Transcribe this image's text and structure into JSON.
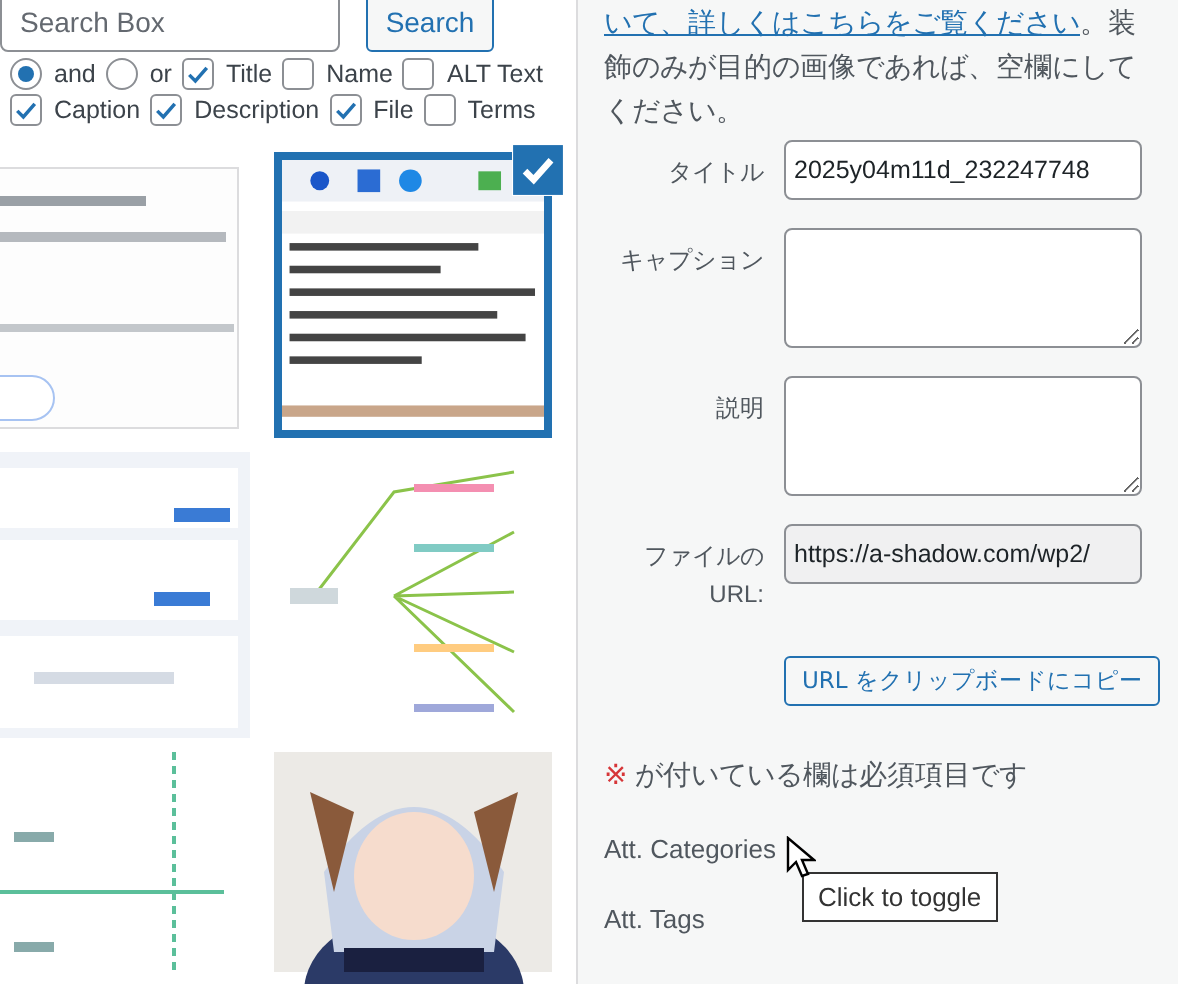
{
  "search": {
    "placeholder": "Search Box",
    "button": "Search"
  },
  "options": [
    {
      "kind": "radio",
      "label": "and",
      "selected": true
    },
    {
      "kind": "radio",
      "label": "or",
      "selected": false
    },
    {
      "kind": "checkbox",
      "label": "Title",
      "checked": true
    },
    {
      "kind": "checkbox",
      "label": "Name",
      "checked": false
    },
    {
      "kind": "checkbox",
      "label": "ALT Text",
      "checked": false
    },
    {
      "kind": "break"
    },
    {
      "kind": "checkbox",
      "label": "Caption",
      "checked": true
    },
    {
      "kind": "checkbox",
      "label": "Description",
      "checked": true
    },
    {
      "kind": "checkbox",
      "label": "File",
      "checked": true
    },
    {
      "kind": "checkbox",
      "label": "Terms",
      "checked": false
    }
  ],
  "thumbnails": [
    {
      "kind": "picture",
      "selected": false
    },
    {
      "kind": "picture",
      "selected": true
    },
    {
      "kind": "picture",
      "selected": false
    },
    {
      "kind": "picture",
      "selected": false
    },
    {
      "kind": "picture",
      "selected": false
    },
    {
      "kind": "picture",
      "selected": false
    }
  ],
  "details": {
    "intro_link": "いて、詳しくはこちらをご覧ください",
    "intro_text": "。装飾のみが目的の画像であれば、空欄にしてください。",
    "fields": [
      {
        "kind": "text",
        "label": "タイトル",
        "value": "2025y04m11d_232247748"
      },
      {
        "kind": "textarea",
        "label": "キャプション"
      },
      {
        "kind": "textarea",
        "label": "説明"
      },
      {
        "kind": "readonly",
        "label": "ファイルの URL:",
        "value": "https://a-shadow.com/wp2/"
      }
    ],
    "copy_button": "URL をクリップボードにコピー",
    "required_mark": "※",
    "required_note": "が付いている欄は必須項目です",
    "sections": [
      "Att. Categories",
      "Att. Tags"
    ],
    "tooltip": "Click to toggle"
  }
}
